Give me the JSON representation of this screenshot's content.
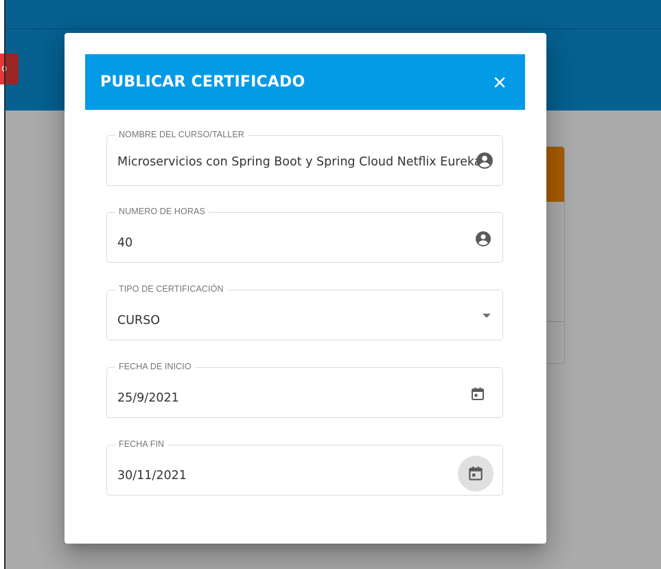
{
  "background": {
    "red_button_label": "o"
  },
  "dialog": {
    "title": "PUBLICAR CERTIFICADO",
    "fields": [
      {
        "label": "NOMBRE DEL CURSO/TALLER",
        "value": "Microservicios con Spring Boot y Spring Cloud Netflix Eureka",
        "icon": "account-circle-icon"
      },
      {
        "label": "NUMERO DE HORAS",
        "value": "40",
        "icon": "account-circle-icon"
      },
      {
        "label": "TIPO DE CERTIFICACIÓN",
        "value": "CURSO",
        "icon": "dropdown-arrow-icon"
      },
      {
        "label": "FECHA DE INICIO",
        "value": "25/9/2021",
        "icon": "calendar-icon"
      },
      {
        "label": "FECHA FIN",
        "value": "30/11/2021",
        "icon": "calendar-icon"
      }
    ]
  },
  "colors": {
    "header": "#039be5",
    "appbar": "#0a91d8",
    "red_button": "#e53935",
    "card_accent": "#fb8c00"
  }
}
